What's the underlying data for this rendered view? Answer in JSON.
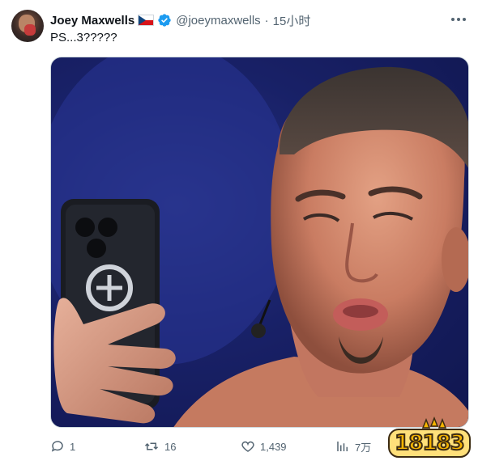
{
  "tweet": {
    "author_name": "Joey Maxwells",
    "handle": "@joeymaxwells",
    "separator": "·",
    "time": "15小时",
    "text": "PS...3?????",
    "flag_icon": "czech-flag-icon",
    "verified_icon": "verified-badge-icon"
  },
  "actions": {
    "replies": "1",
    "retweets": "16",
    "likes": "1,439",
    "views": "7万"
  },
  "watermark": {
    "text": "18183"
  },
  "colors": {
    "text_primary": "#0f1419",
    "text_secondary": "#536471",
    "verified_blue": "#1d9bf0",
    "border": "#cfd9de",
    "watermark_yellow": "#f5b400"
  }
}
